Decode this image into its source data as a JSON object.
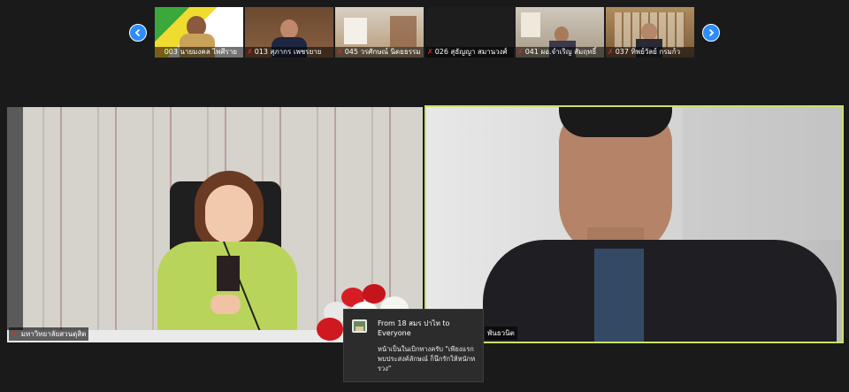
{
  "participants": [
    {
      "name": "003 นายมงคล ไพศีราย"
    },
    {
      "name": "013 สุภากร เพชรยาย"
    },
    {
      "name": "045 วรศักษณ์ นิตยธรรม"
    },
    {
      "name": "026 สุธัญญา สมานวงศ์"
    },
    {
      "name": "041 ผอ.จำเริญ สัมฤทธิ์"
    },
    {
      "name": "037 ทิพย์วัลย์ กรมก้ว"
    }
  ],
  "main_left": {
    "name": "มหาวิทยาลัยสวนดุสิต"
  },
  "main_right": {
    "name": "พันธวนิต"
  },
  "chat": {
    "from": "From 18 สมร ปาไท to Everyone",
    "message": "หน้าเป็นในเบิกทางครับ \"เพียงแรกพบประสงค์ลักษณ์ ก็นึกรักให้หนักหรวง\""
  },
  "colors": {
    "accent": "#2d8cff",
    "active_speaker": "#c7e36a",
    "muted": "#e02828"
  },
  "icons": {
    "prev": "chevron-left-icon",
    "next": "chevron-right-icon",
    "muted": "mic-muted-icon"
  }
}
